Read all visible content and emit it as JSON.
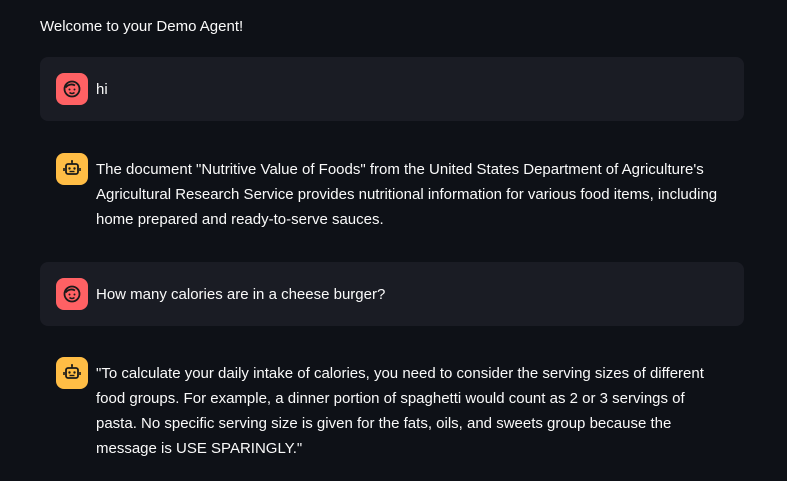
{
  "header": {
    "welcome": "Welcome to your Demo Agent!"
  },
  "chat": {
    "messages": [
      {
        "role": "user",
        "avatar_icon": "user-face-icon",
        "text": "hi"
      },
      {
        "role": "assistant",
        "avatar_icon": "robot-icon",
        "text": "The document \"Nutritive Value of Foods\" from the United States Department of Agriculture's Agricultural Research Service provides nutritional information for various food items, including home prepared and ready-to-serve sauces."
      },
      {
        "role": "user",
        "avatar_icon": "user-face-icon",
        "text": "How many calories are in a cheese burger?"
      },
      {
        "role": "assistant",
        "avatar_icon": "robot-icon",
        "text": "\"To calculate your daily intake of calories, you need to consider the serving sizes of different food groups. For example, a dinner portion of spaghetti would count as 2 or 3 servings of pasta. No specific serving size is given for the fats, oils, and sweets group because the message is USE SPARINGLY.\""
      }
    ]
  },
  "colors": {
    "background": "#0e1117",
    "user_bubble": "#1a1c24",
    "user_avatar": "#ff6164",
    "assistant_avatar": "#ffbd45",
    "text": "#fafafa"
  }
}
